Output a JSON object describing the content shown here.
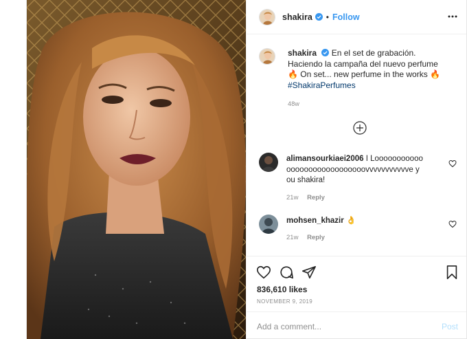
{
  "header": {
    "username": "shakira",
    "dot": "•",
    "follow_label": "Follow",
    "verified_icon": "verified-badge-icon",
    "more_icon": "more-options-icon"
  },
  "caption": {
    "username": "shakira",
    "text_line1": "En el set de grabación. Haciendo la campaña del nuevo perfume",
    "emoji1": "🔥",
    "text_line2": "On set... new perfume in the works",
    "emoji2": "🔥",
    "hashtag": "#ShakiraPerfumes",
    "age": "48w"
  },
  "comments": [
    {
      "username": "alimansourkiaei2006",
      "text": "I Looooooooooooooooooooooooooooovvvvvvvvvvve you shakira!",
      "age": "21w",
      "reply_label": "Reply"
    },
    {
      "username": "mohsen_khazir",
      "text": "👌",
      "age": "21w",
      "reply_label": "Reply"
    }
  ],
  "actions": {
    "likes": "836,610 likes",
    "date": "NOVEMBER 9, 2019"
  },
  "add_comment": {
    "placeholder": "Add a comment...",
    "post_label": "Post"
  },
  "colors": {
    "link_blue": "#3897f0",
    "hashtag": "#00376b",
    "muted": "#8e8e8e",
    "post_disabled": "#b2dffc"
  }
}
